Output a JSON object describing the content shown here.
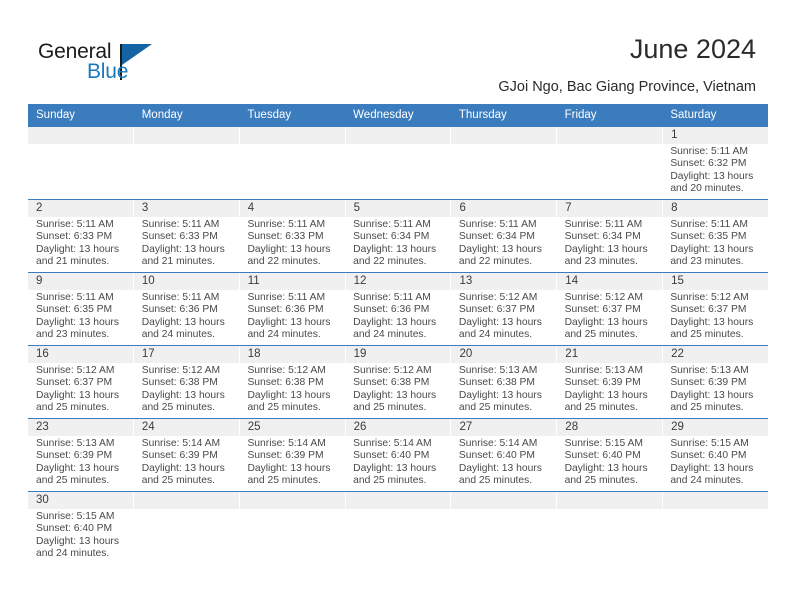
{
  "brand": {
    "name_part1": "General",
    "name_part2": "Blue",
    "accent_color": "#1878be",
    "triangle_color": "#1464a5"
  },
  "header": {
    "title": "June 2024",
    "subtitle": "GJoi Ngo, Bac Giang Province, Vietnam",
    "header_bg_color": "#3a7cbe",
    "date_strip_color": "#f0f0f0"
  },
  "weekdays": [
    "Sunday",
    "Monday",
    "Tuesday",
    "Wednesday",
    "Thursday",
    "Friday",
    "Saturday"
  ],
  "weeks": [
    [
      {
        "date": "",
        "lines": [
          "",
          "",
          "",
          ""
        ]
      },
      {
        "date": "",
        "lines": [
          "",
          "",
          "",
          ""
        ]
      },
      {
        "date": "",
        "lines": [
          "",
          "",
          "",
          ""
        ]
      },
      {
        "date": "",
        "lines": [
          "",
          "",
          "",
          ""
        ]
      },
      {
        "date": "",
        "lines": [
          "",
          "",
          "",
          ""
        ]
      },
      {
        "date": "",
        "lines": [
          "",
          "",
          "",
          ""
        ]
      },
      {
        "date": "1",
        "lines": [
          "Sunrise: 5:11 AM",
          "Sunset: 6:32 PM",
          "Daylight: 13 hours",
          "and 20 minutes."
        ]
      }
    ],
    [
      {
        "date": "2",
        "lines": [
          "Sunrise: 5:11 AM",
          "Sunset: 6:33 PM",
          "Daylight: 13 hours",
          "and 21 minutes."
        ]
      },
      {
        "date": "3",
        "lines": [
          "Sunrise: 5:11 AM",
          "Sunset: 6:33 PM",
          "Daylight: 13 hours",
          "and 21 minutes."
        ]
      },
      {
        "date": "4",
        "lines": [
          "Sunrise: 5:11 AM",
          "Sunset: 6:33 PM",
          "Daylight: 13 hours",
          "and 22 minutes."
        ]
      },
      {
        "date": "5",
        "lines": [
          "Sunrise: 5:11 AM",
          "Sunset: 6:34 PM",
          "Daylight: 13 hours",
          "and 22 minutes."
        ]
      },
      {
        "date": "6",
        "lines": [
          "Sunrise: 5:11 AM",
          "Sunset: 6:34 PM",
          "Daylight: 13 hours",
          "and 22 minutes."
        ]
      },
      {
        "date": "7",
        "lines": [
          "Sunrise: 5:11 AM",
          "Sunset: 6:34 PM",
          "Daylight: 13 hours",
          "and 23 minutes."
        ]
      },
      {
        "date": "8",
        "lines": [
          "Sunrise: 5:11 AM",
          "Sunset: 6:35 PM",
          "Daylight: 13 hours",
          "and 23 minutes."
        ]
      }
    ],
    [
      {
        "date": "9",
        "lines": [
          "Sunrise: 5:11 AM",
          "Sunset: 6:35 PM",
          "Daylight: 13 hours",
          "and 23 minutes."
        ]
      },
      {
        "date": "10",
        "lines": [
          "Sunrise: 5:11 AM",
          "Sunset: 6:36 PM",
          "Daylight: 13 hours",
          "and 24 minutes."
        ]
      },
      {
        "date": "11",
        "lines": [
          "Sunrise: 5:11 AM",
          "Sunset: 6:36 PM",
          "Daylight: 13 hours",
          "and 24 minutes."
        ]
      },
      {
        "date": "12",
        "lines": [
          "Sunrise: 5:11 AM",
          "Sunset: 6:36 PM",
          "Daylight: 13 hours",
          "and 24 minutes."
        ]
      },
      {
        "date": "13",
        "lines": [
          "Sunrise: 5:12 AM",
          "Sunset: 6:37 PM",
          "Daylight: 13 hours",
          "and 24 minutes."
        ]
      },
      {
        "date": "14",
        "lines": [
          "Sunrise: 5:12 AM",
          "Sunset: 6:37 PM",
          "Daylight: 13 hours",
          "and 25 minutes."
        ]
      },
      {
        "date": "15",
        "lines": [
          "Sunrise: 5:12 AM",
          "Sunset: 6:37 PM",
          "Daylight: 13 hours",
          "and 25 minutes."
        ]
      }
    ],
    [
      {
        "date": "16",
        "lines": [
          "Sunrise: 5:12 AM",
          "Sunset: 6:37 PM",
          "Daylight: 13 hours",
          "and 25 minutes."
        ]
      },
      {
        "date": "17",
        "lines": [
          "Sunrise: 5:12 AM",
          "Sunset: 6:38 PM",
          "Daylight: 13 hours",
          "and 25 minutes."
        ]
      },
      {
        "date": "18",
        "lines": [
          "Sunrise: 5:12 AM",
          "Sunset: 6:38 PM",
          "Daylight: 13 hours",
          "and 25 minutes."
        ]
      },
      {
        "date": "19",
        "lines": [
          "Sunrise: 5:12 AM",
          "Sunset: 6:38 PM",
          "Daylight: 13 hours",
          "and 25 minutes."
        ]
      },
      {
        "date": "20",
        "lines": [
          "Sunrise: 5:13 AM",
          "Sunset: 6:38 PM",
          "Daylight: 13 hours",
          "and 25 minutes."
        ]
      },
      {
        "date": "21",
        "lines": [
          "Sunrise: 5:13 AM",
          "Sunset: 6:39 PM",
          "Daylight: 13 hours",
          "and 25 minutes."
        ]
      },
      {
        "date": "22",
        "lines": [
          "Sunrise: 5:13 AM",
          "Sunset: 6:39 PM",
          "Daylight: 13 hours",
          "and 25 minutes."
        ]
      }
    ],
    [
      {
        "date": "23",
        "lines": [
          "Sunrise: 5:13 AM",
          "Sunset: 6:39 PM",
          "Daylight: 13 hours",
          "and 25 minutes."
        ]
      },
      {
        "date": "24",
        "lines": [
          "Sunrise: 5:14 AM",
          "Sunset: 6:39 PM",
          "Daylight: 13 hours",
          "and 25 minutes."
        ]
      },
      {
        "date": "25",
        "lines": [
          "Sunrise: 5:14 AM",
          "Sunset: 6:39 PM",
          "Daylight: 13 hours",
          "and 25 minutes."
        ]
      },
      {
        "date": "26",
        "lines": [
          "Sunrise: 5:14 AM",
          "Sunset: 6:40 PM",
          "Daylight: 13 hours",
          "and 25 minutes."
        ]
      },
      {
        "date": "27",
        "lines": [
          "Sunrise: 5:14 AM",
          "Sunset: 6:40 PM",
          "Daylight: 13 hours",
          "and 25 minutes."
        ]
      },
      {
        "date": "28",
        "lines": [
          "Sunrise: 5:15 AM",
          "Sunset: 6:40 PM",
          "Daylight: 13 hours",
          "and 25 minutes."
        ]
      },
      {
        "date": "29",
        "lines": [
          "Sunrise: 5:15 AM",
          "Sunset: 6:40 PM",
          "Daylight: 13 hours",
          "and 24 minutes."
        ]
      }
    ],
    [
      {
        "date": "30",
        "lines": [
          "Sunrise: 5:15 AM",
          "Sunset: 6:40 PM",
          "Daylight: 13 hours",
          "and 24 minutes."
        ]
      },
      {
        "date": "",
        "lines": [
          "",
          "",
          "",
          ""
        ]
      },
      {
        "date": "",
        "lines": [
          "",
          "",
          "",
          ""
        ]
      },
      {
        "date": "",
        "lines": [
          "",
          "",
          "",
          ""
        ]
      },
      {
        "date": "",
        "lines": [
          "",
          "",
          "",
          ""
        ]
      },
      {
        "date": "",
        "lines": [
          "",
          "",
          "",
          ""
        ]
      },
      {
        "date": "",
        "lines": [
          "",
          "",
          "",
          ""
        ]
      }
    ]
  ]
}
